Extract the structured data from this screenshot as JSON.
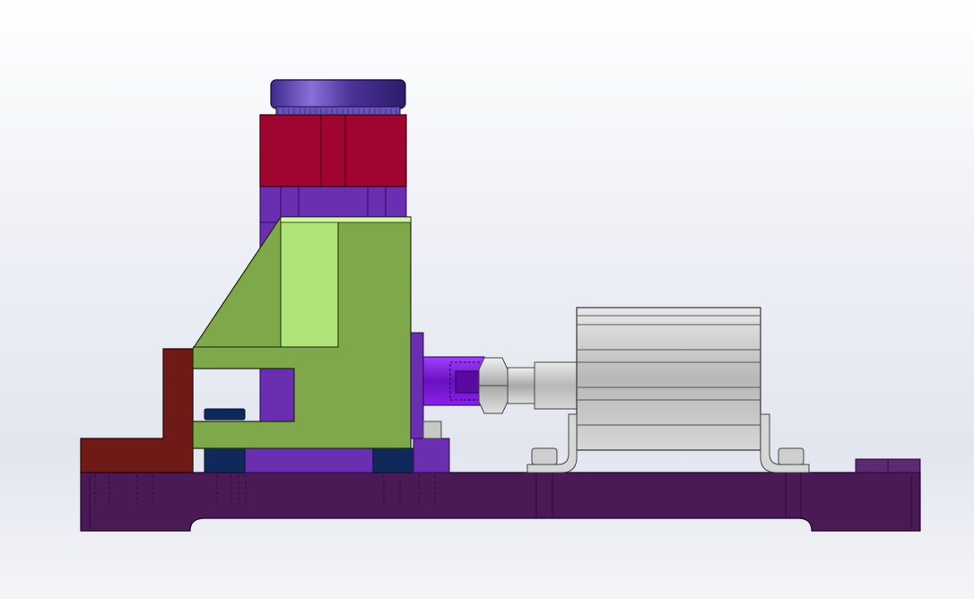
{
  "viewport": {
    "background_top": "#ffffff",
    "background_mid": "#e3e6ef"
  },
  "parts": [
    {
      "name": "base-plate",
      "color": "#4a1a57"
    },
    {
      "name": "red-bracket",
      "color": "#6e1a16"
    },
    {
      "name": "green-arm",
      "color": "#7ea84a"
    },
    {
      "name": "green-arm-highlight",
      "color": "#b0e379"
    },
    {
      "name": "purple-column",
      "color": "#6a2fb0"
    },
    {
      "name": "crimson-block",
      "color": "#a00530"
    },
    {
      "name": "knob-cap",
      "color": "#5a3aa8"
    },
    {
      "name": "navy-spacer",
      "color": "#0f2a5a"
    },
    {
      "name": "pneumatic-cylinder",
      "color": "#cfcfcf"
    },
    {
      "name": "hex-nut",
      "color": "#c8c8c8"
    },
    {
      "name": "violet-coupling",
      "color": "#8a1ee0"
    }
  ]
}
